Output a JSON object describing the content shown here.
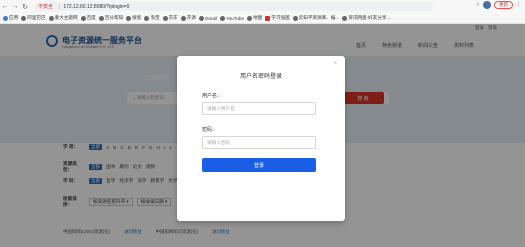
{
  "browser": {
    "security_label": "不安全",
    "url": "172.12.60.12:8080/?iplogin=0",
    "update_label": "更新",
    "bookmarks": [
      "应用",
      "阿里巴巴",
      "重大主题网",
      "百度",
      "百分帮知",
      "搜索",
      "淘宝",
      "京东",
      "开源",
      "Gmail",
      "YouTube",
      "地图",
      "学习强国",
      "云知平资源库、编...",
      "资讯网盘-好友分享..."
    ]
  },
  "site": {
    "top_links": [
      "登录",
      "登录"
    ],
    "brand_title": "电子资源统一服务平台",
    "brand_subtitle": "Hangzhou Lib Software CO.,LTD",
    "nav": [
      "首页",
      "特色频道",
      "新闻公告",
      "资料列表"
    ],
    "banner_title": "资源推荐",
    "search_placeholder": "请输入检索词",
    "search_button": "搜 索",
    "filters": [
      {
        "label": "字 母：",
        "active": "全部",
        "items": [
          "A",
          "B",
          "C",
          "D",
          "E",
          "F",
          "G",
          "H",
          "I",
          "J"
        ]
      },
      {
        "label": "资源类型：",
        "active": "全部",
        "items": [
          "图书",
          "期刊",
          "论文",
          "视频"
        ]
      },
      {
        "label": "学 科：",
        "active": "全部",
        "items": [
          "哲学",
          "经济学",
          "法学",
          "教育学",
          "文学",
          "历史学",
          "理学",
          "工学",
          "农学",
          "医学",
          "管理学",
          "艺术学",
          "交叉学科",
          "综合"
        ]
      }
    ],
    "sort_label": "检索排序：",
    "sort_value": "按资源名称升序 ▾",
    "sort_value2": "按收录日期 ▾",
    "results": [
      {
        "name": "中国知网(CNKI)资源(在)",
        "link": "访问地址"
      },
      {
        "name": "中国知网知识资源(在)",
        "link": "访问地址"
      }
    ]
  },
  "login": {
    "title": "用户名密码登录",
    "close": "×",
    "username_label": "用户名：",
    "username_placeholder": "请输入用户名",
    "password_label": "密码：",
    "password_placeholder": "请输入密码",
    "submit": "登录"
  }
}
